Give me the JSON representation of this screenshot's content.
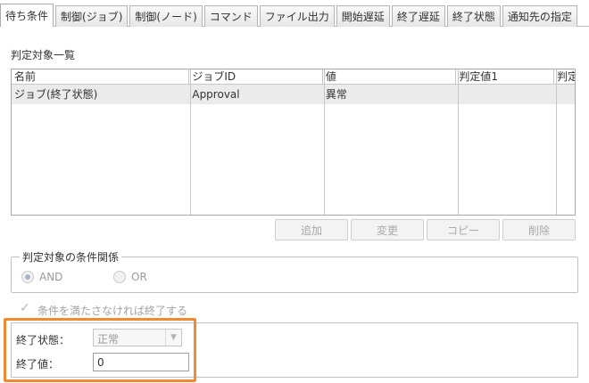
{
  "tabs": [
    "待ち条件",
    "制御(ジョブ)",
    "制御(ノード)",
    "コマンド",
    "ファイル出力",
    "開始遅延",
    "終了遅延",
    "終了状態",
    "通知先の指定"
  ],
  "section_title": "判定対象一覧",
  "table": {
    "columns": [
      "名前",
      "ジョブID",
      "値",
      "判定値1",
      "判定"
    ],
    "rows": [
      [
        "ジョブ(終了状態)",
        "Approval",
        "異常",
        "",
        ""
      ]
    ]
  },
  "buttons": {
    "add": "追加",
    "modify": "変更",
    "copy": "コピー",
    "delete": "削除"
  },
  "condition_group": {
    "legend": "判定対象の条件関係",
    "and_label": "AND",
    "or_label": "OR",
    "selected": "AND"
  },
  "end_if_unmet": {
    "label": "条件を満たさなければ終了する",
    "checked": true
  },
  "end_status": {
    "label": "終了状態：",
    "value": "正常"
  },
  "end_value": {
    "label": "終了値：",
    "value": "0"
  },
  "colors": {
    "highlight": "#f08b33"
  }
}
